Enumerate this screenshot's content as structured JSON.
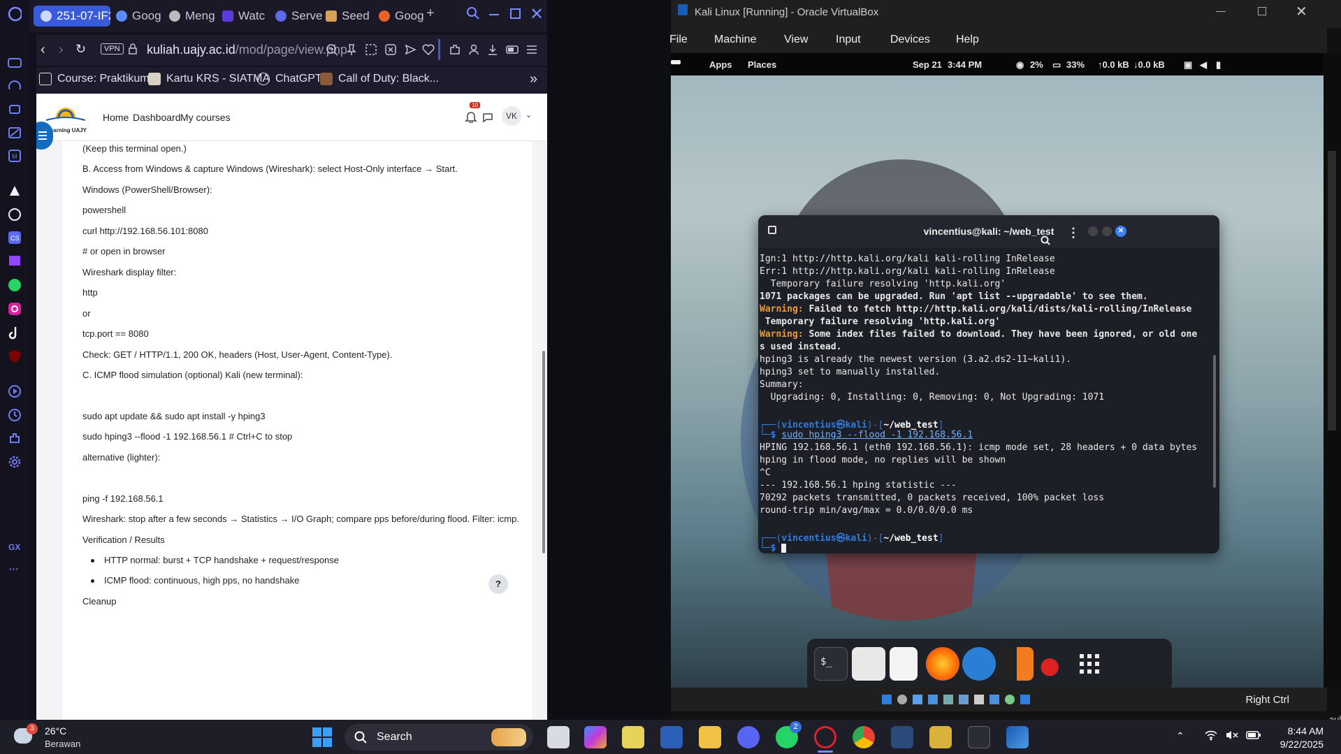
{
  "browser": {
    "tabs": [
      {
        "label": "251-07-IF2",
        "active": true
      },
      {
        "label": "Goog"
      },
      {
        "label": "Meng"
      },
      {
        "label": "Watc"
      },
      {
        "label": "Serve"
      },
      {
        "label": "Seed"
      },
      {
        "label": "Goog"
      }
    ],
    "vpn_label": "VPN",
    "url_domain": "kuliah.uajy.ac.id",
    "url_path": "/mod/page/view.php",
    "bookmarks": [
      {
        "label": "Course: Praktikum..."
      },
      {
        "label": "Kartu KRS - SIATMA"
      },
      {
        "label": "ChatGPT"
      },
      {
        "label": "Call of Duty: Black..."
      }
    ],
    "sidebar_labels": {
      "gx": "GX",
      "more": "···"
    }
  },
  "moodle": {
    "logo_text": "Elearning UAJY",
    "nav": [
      "Home",
      "Dashboard",
      "My courses"
    ],
    "notifications_count": "10",
    "avatar_initials": "VK",
    "help_label": "?",
    "lines": [
      "(Keep this terminal open.)",
      "B. Access from Windows & capture Windows (Wireshark): select Host-Only interface → Start.",
      "Windows (PowerShell/Browser):",
      "powershell",
      "curl http://192.168.56.101:8080",
      "# or open in browser",
      "Wireshark display filter:",
      "http",
      "or",
      "tcp.port == 8080",
      "Check: GET / HTTP/1.1, 200 OK, headers (Host, User-Agent, Content-Type).",
      "C. ICMP flood simulation (optional) Kali (new terminal):",
      "sudo apt update && sudo apt install -y hping3",
      "sudo hping3 --flood -1 192.168.56.1   # Ctrl+C to stop",
      "alternative (lighter):",
      "ping -f 192.168.56.1",
      "Wireshark: stop after a few seconds → Statistics → I/O Graph; compare pps before/during flood. Filter: icmp.",
      "Verification / Results",
      "HTTP normal: burst + TCP handshake + request/response",
      "ICMP flood: continuous, high pps, no handshake",
      "Cleanup"
    ]
  },
  "virtualbox": {
    "title": "Kali Linux  [Running] - Oracle VirtualBox",
    "menu": [
      "File",
      "Machine",
      "View",
      "Input",
      "Devices",
      "Help"
    ],
    "host_key": "Right Ctrl",
    "side_text": "ault"
  },
  "kali": {
    "topbar": {
      "apps": "Apps",
      "places": "Places",
      "date": "Sep 21",
      "time": "3:44 PM",
      "cpu": "2%",
      "mem": "33%",
      "up": "↑0.0 kB",
      "down": "↓0.0 kB"
    },
    "terminal": {
      "title": "vincentius@kali: ~/web_test",
      "prompt_user": "vincentius㉿kali",
      "prompt_dir": "~/web_test",
      "command": "sudo hping3 --flood -1 192.168.56.1",
      "lines": [
        "Ign:1 http://http.kali.org/kali kali-rolling InRelease",
        "Err:1 http://http.kali.org/kali kali-rolling InRelease",
        "  Temporary failure resolving 'http.kali.org'",
        "1071 packages can be upgraded. Run 'apt list --upgradable' to see them.",
        "Warning:",
        " Failed to fetch http://http.kali.org/kali/dists/kali-rolling/InRelease",
        " Temporary failure resolving 'http.kali.org'",
        " Some index files failed to download. They have been ignored, or old one",
        "s used instead.",
        "hping3 is already the newest version (3.a2.ds2-11~kali1).",
        "hping3 set to manually installed.",
        "Summary:",
        "  Upgrading: 0, Installing: 0, Removing: 0, Not Upgrading: 1071",
        "HPING 192.168.56.1 (eth0 192.168.56.1): icmp mode set, 28 headers + 0 data bytes",
        "hping in flood mode, no replies will be shown",
        "^C",
        "--- 192.168.56.1 hping statistic ---",
        "70292 packets transmitted, 0 packets received, 100% packet loss",
        "round-trip min/avg/max = 0.0/0.0/0.0 ms"
      ]
    }
  },
  "taskbar": {
    "weather_temp": "26°C",
    "weather_desc": "Berawan",
    "weather_badge": "3",
    "search_label": "Search",
    "whatsapp_badge": "2",
    "time": "8:44 AM",
    "date": "9/22/2025"
  },
  "colors": {
    "opera_tab_active": "#3a5bd9",
    "moodle_nav_bg": "#ffffff",
    "terminal_bg": "#1c1f26",
    "prompt_blue": "#2f7de1",
    "warning_orange": "#f29a33",
    "taskbar_bg": "#1e1e28"
  }
}
